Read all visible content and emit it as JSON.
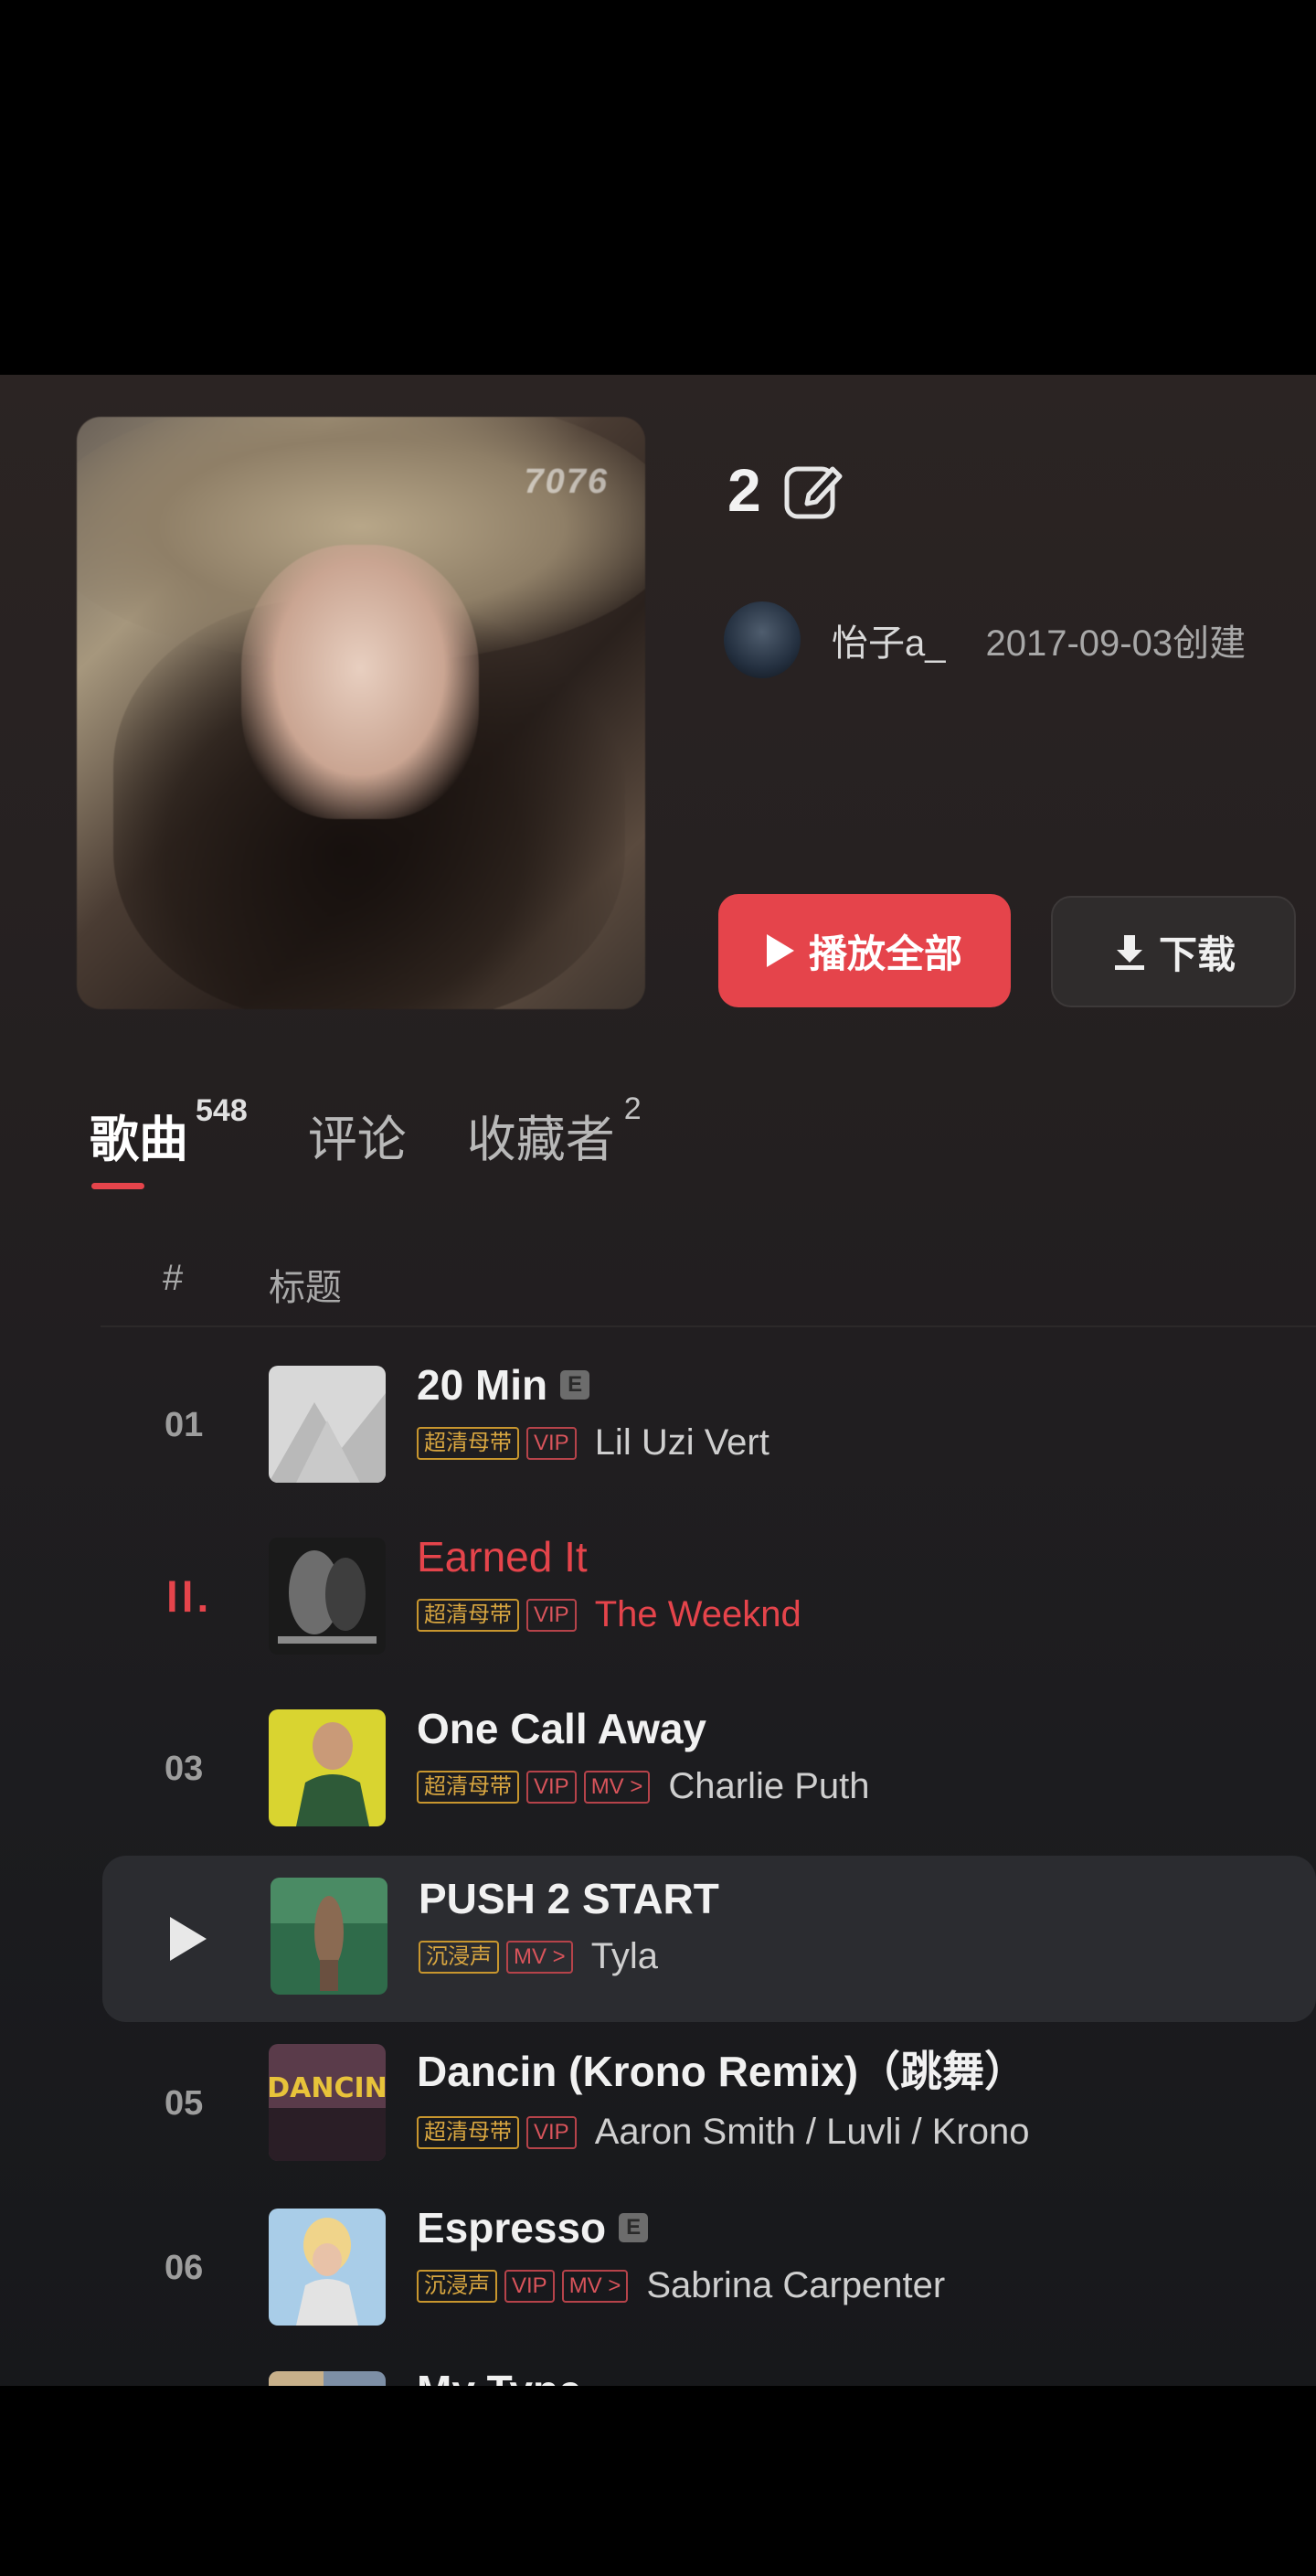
{
  "playlist": {
    "cover_label": "7076",
    "title": "2",
    "creator": "怡子a_",
    "created": "2017-09-03创建",
    "play_all_label": "播放全部",
    "download_label": "下载"
  },
  "tabs": [
    {
      "label": "歌曲",
      "count": "548"
    },
    {
      "label": "评论",
      "count": ""
    },
    {
      "label": "收藏者",
      "count": "2"
    }
  ],
  "table": {
    "col_num": "#",
    "col_title": "标题"
  },
  "songs": [
    {
      "index": "01",
      "title": "20 Min",
      "explicit": "E",
      "tags": [
        "超清母带",
        "VIP"
      ],
      "artist": "Lil Uzi Vert"
    },
    {
      "index": "",
      "title": "Earned It",
      "explicit": "",
      "tags": [
        "超清母带",
        "VIP"
      ],
      "artist": "The Weeknd",
      "state": "playing",
      "playing_glyph": "ll."
    },
    {
      "index": "03",
      "title": "One Call Away",
      "explicit": "",
      "tags": [
        "超清母带",
        "VIP",
        "MV >"
      ],
      "artist": "Charlie Puth"
    },
    {
      "index": "",
      "title": "PUSH 2 START",
      "explicit": "",
      "tags": [
        "沉浸声",
        "MV >"
      ],
      "artist": "Tyla",
      "state": "hover"
    },
    {
      "index": "05",
      "title": "Dancin (Krono Remix)（跳舞）",
      "explicit": "",
      "tags": [
        "超清母带",
        "VIP"
      ],
      "artist": "Aaron Smith / Luvli / Krono"
    },
    {
      "index": "06",
      "title": "Espresso",
      "explicit": "E",
      "tags": [
        "沉浸声",
        "VIP",
        "MV >"
      ],
      "artist": "Sabrina Carpenter"
    },
    {
      "index": "",
      "title": "My Type",
      "explicit": "",
      "tags": [],
      "artist": ""
    }
  ],
  "colors": {
    "accent": "#e5444b",
    "tag_gold": "#c8962e",
    "background": "#231f20"
  },
  "icons": {
    "edit": "edit-icon",
    "download": "download-icon",
    "play": "play-icon"
  }
}
